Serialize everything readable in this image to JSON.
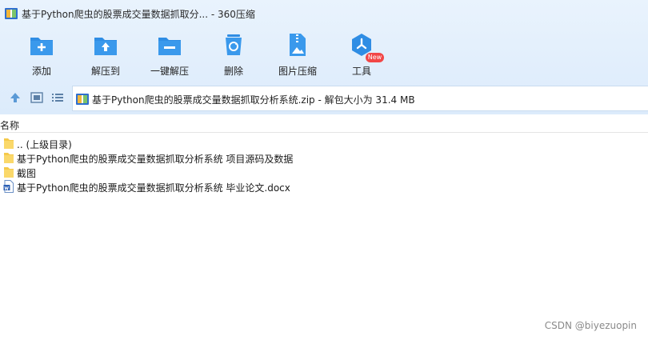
{
  "window": {
    "title": "基于Python爬虫的股票成交量数据抓取分... - 360压缩",
    "app_icon": "archive-app-icon"
  },
  "toolbar": {
    "items": [
      {
        "label": "添加",
        "icon": "add-folder-icon"
      },
      {
        "label": "解压到",
        "icon": "extract-to-icon"
      },
      {
        "label": "一键解压",
        "icon": "one-click-extract-icon"
      },
      {
        "label": "删除",
        "icon": "recycle-delete-icon"
      },
      {
        "label": "图片压缩",
        "icon": "image-compress-icon"
      },
      {
        "label": "工具",
        "icon": "tools-icon"
      }
    ],
    "badge": "New"
  },
  "address": {
    "text": "基于Python爬虫的股票成交量数据抓取分析系统.zip - 解包大小为 31.4 MB"
  },
  "list": {
    "column_header": "名称",
    "rows": [
      {
        "name": ".. (上级目录)",
        "type": "folder"
      },
      {
        "name": "基于Python爬虫的股票成交量数据抓取分析系统 项目源码及数据",
        "type": "folder"
      },
      {
        "name": "截图",
        "type": "folder"
      },
      {
        "name": "基于Python爬虫的股票成交量数据抓取分析系统 毕业论文.docx",
        "type": "docx"
      }
    ]
  },
  "watermark": "CSDN @biyezuopin",
  "colors": {
    "accent": "#2f8de4",
    "header_bg": "#e3effc",
    "badge": "#f24747",
    "folder": "#f5c94a"
  }
}
